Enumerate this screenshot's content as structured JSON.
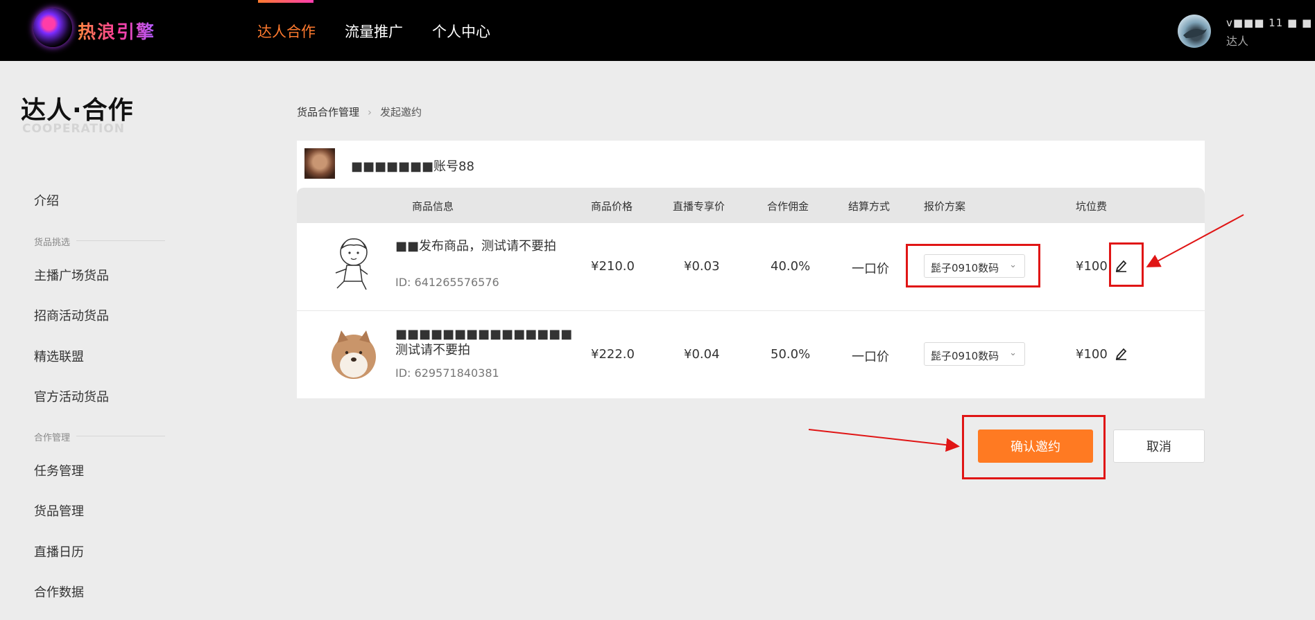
{
  "header": {
    "logo_text": "热浪引擎",
    "nav": [
      {
        "label": "达人合作",
        "active": true
      },
      {
        "label": "流量推广",
        "active": false
      },
      {
        "label": "个人中心",
        "active": false
      }
    ],
    "user": {
      "name": "v■■■ 11 ■ ■",
      "role": "达人"
    }
  },
  "sidebar": {
    "brand_title": "达人·合作",
    "brand_sub": "COOPERATION",
    "intro": "介绍",
    "group1": "货品挑选",
    "group1_items": [
      "主播广场货品",
      "招商活动货品",
      "精选联盟",
      "官方活动货品"
    ],
    "group2": "合作管理",
    "group2_items": [
      "任务管理",
      "货品管理",
      "直播日历",
      "合作数据"
    ]
  },
  "breadcrumb": {
    "parent": "货品合作管理",
    "current": "发起邀约"
  },
  "account": {
    "name": "■■■■■■■账号88"
  },
  "table": {
    "headers": [
      "商品信息",
      "商品价格",
      "直播专享价",
      "合作佣金",
      "结算方式",
      "报价方案",
      "坑位费"
    ],
    "rows": [
      {
        "name": "■■发布商品，测试请不要拍",
        "id": "ID: 641265576576",
        "price": "¥210.0",
        "live_price": "¥0.03",
        "commission": "40.0%",
        "settlement": "一口价",
        "quote_plan": "髭子0910数码",
        "slot_fee": "¥100"
      },
      {
        "name": "■■■■■■■■■■■■■■■测试请不要拍",
        "id": "ID: 629571840381",
        "price": "¥222.0",
        "live_price": "¥0.04",
        "commission": "50.0%",
        "settlement": "一口价",
        "quote_plan": "髭子0910数码",
        "slot_fee": "¥100"
      }
    ]
  },
  "actions": {
    "confirm": "确认邀约",
    "cancel": "取消"
  },
  "colors": {
    "accent": "#ff7a22",
    "annotation": "#e01515",
    "topbar": "#000000"
  }
}
